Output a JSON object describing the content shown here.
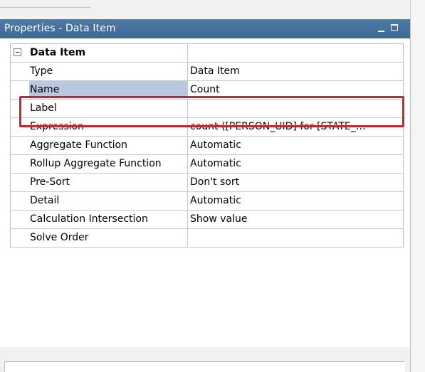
{
  "panel": {
    "title": "Properties - Data Item"
  },
  "group": {
    "label": "Data Item"
  },
  "properties": [
    {
      "name": "Type",
      "value": "Data Item"
    },
    {
      "name": "Name",
      "value": "Count"
    },
    {
      "name": "Label",
      "value": ""
    },
    {
      "name": "Expression",
      "value": "count ([PERSON_UID] for [STATE_…"
    },
    {
      "name": "Aggregate Function",
      "value": "Automatic"
    },
    {
      "name": "Rollup Aggregate Function",
      "value": "Automatic"
    },
    {
      "name": "Pre-Sort",
      "value": "Don't sort"
    },
    {
      "name": "Detail",
      "value": "Automatic"
    },
    {
      "name": "Calculation Intersection",
      "value": "Show value"
    },
    {
      "name": "Solve Order",
      "value": ""
    }
  ],
  "icons": {
    "expander": "collapse-icon",
    "minimize": "minimize-icon",
    "maximize": "maximize-icon"
  },
  "colors": {
    "titlebar": "#3e6896",
    "selected_row": "#b9c7df",
    "highlight_box": "#c1272d"
  }
}
